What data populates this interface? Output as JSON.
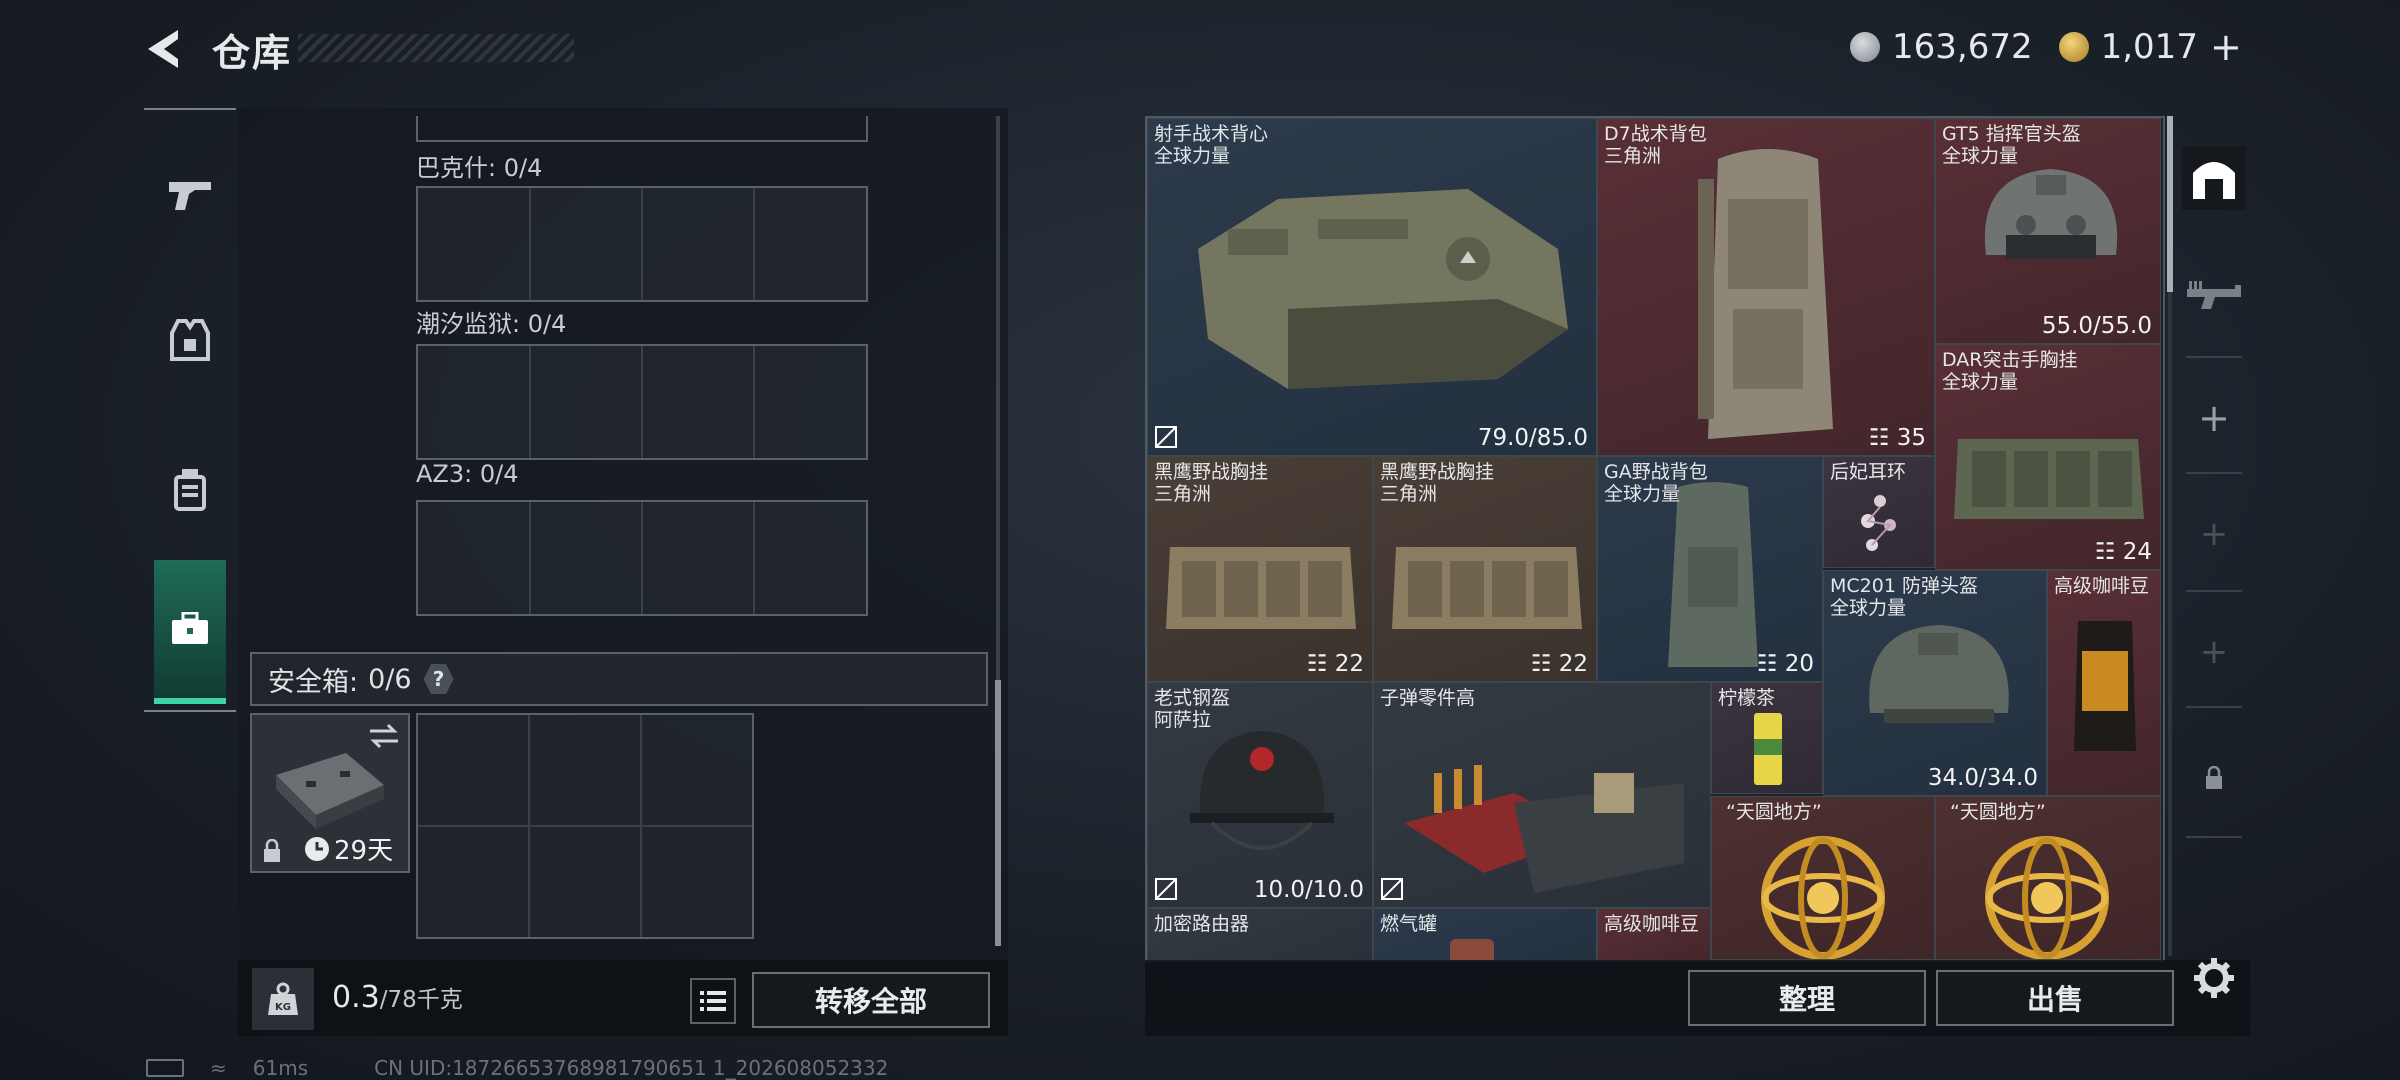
{
  "header": {
    "title": "仓库"
  },
  "currency": {
    "silver": "163,672",
    "gold": "1,017",
    "plus": "+"
  },
  "sidebar": {
    "tabs": [
      {
        "name": "weapons",
        "active": false
      },
      {
        "name": "gear",
        "active": false
      },
      {
        "name": "consumables",
        "active": false
      },
      {
        "name": "safe-box",
        "active": true
      }
    ]
  },
  "stash": {
    "boxes": [
      {
        "label": "巴克什: 0/4"
      },
      {
        "label": "潮汐监狱: 0/4"
      },
      {
        "label": "AZ3: 0/4"
      }
    ],
    "safe_box": {
      "label": "安全箱:",
      "count": "0/6",
      "help": "?",
      "timer": "29天"
    },
    "weight": {
      "current": "0.3",
      "capacity": "/78千克"
    },
    "transfer_all": "转移全部"
  },
  "inventory": {
    "items": [
      {
        "name": "射手战术背心",
        "sub": "全球力量",
        "durability": "79.0/85.0"
      },
      {
        "name": "D7战术背包",
        "sub": "三角洲",
        "count": "35"
      },
      {
        "name": "GT5 指挥官头盔",
        "sub": "全球力量",
        "durability": "55.0/55.0"
      },
      {
        "name": "DAR突击手胸挂",
        "sub": "全球力量",
        "count": "24"
      },
      {
        "name": "黑鹰野战胸挂",
        "sub": "三角洲",
        "count": "22"
      },
      {
        "name": "黑鹰野战胸挂",
        "sub": "三角洲",
        "count": "22"
      },
      {
        "name": "GA野战背包",
        "sub": "全球力量",
        "count": "20"
      },
      {
        "name": "后妃耳环",
        "sub": ""
      },
      {
        "name": "MC201 防弹头盔",
        "sub": "全球力量",
        "durability": "34.0/34.0"
      },
      {
        "name": "高级咖啡豆",
        "sub": ""
      },
      {
        "name": "老式钢盔",
        "sub": "阿萨拉",
        "durability": "10.0/10.0"
      },
      {
        "name": "子弹零件高",
        "sub": ""
      },
      {
        "name": "柠檬茶",
        "sub": ""
      },
      {
        "name": "“天圆地方”",
        "sub": ""
      },
      {
        "name": "“天圆地方”",
        "sub": ""
      },
      {
        "name": "加密路由器",
        "sub": ""
      },
      {
        "name": "燃气罐",
        "sub": ""
      },
      {
        "name": "高级咖啡豆",
        "sub": ""
      }
    ],
    "sort_button": "整理",
    "sell_button": "出售"
  },
  "status": {
    "ping": "61ms",
    "uid": "CN UID:18726653768981790651 1_202608052332"
  },
  "colors": {
    "accent_green": "#3fd4a5",
    "cell_red": "#5a2f36",
    "cell_blue": "#2c3a4b",
    "cell_brown": "#4a3f37"
  }
}
